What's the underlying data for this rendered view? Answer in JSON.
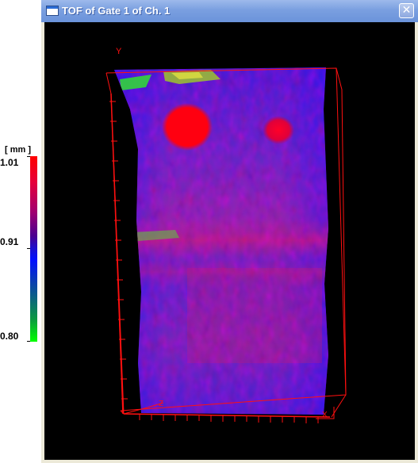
{
  "window": {
    "title": "TOF of Gate 1 of Ch. 1",
    "close_glyph": "✕"
  },
  "color_scale": {
    "unit": "[ mm ]",
    "max_label": "1.01",
    "mid_label": "0.91",
    "min_label": "0.80",
    "colors": [
      "#ff0000",
      "#a10070",
      "#0010ff",
      "#0b6a78",
      "#00ff00"
    ]
  },
  "view": {
    "axis_y_label": "Y",
    "axis_x_label": "X",
    "axis_z_label": "Z"
  }
}
